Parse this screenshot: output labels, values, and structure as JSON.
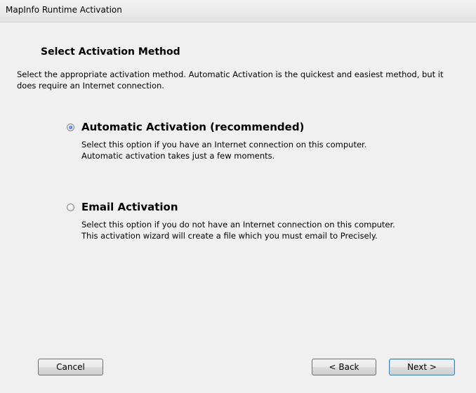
{
  "window": {
    "title": "MapInfo Runtime Activation"
  },
  "page": {
    "heading": "Select Activation Method",
    "intro": "Select the appropriate activation method.  Automatic Activation is the quickest and easiest method, but it does require an Internet connection."
  },
  "options": [
    {
      "label": "Automatic Activation (recommended)",
      "description": "Select this option if you have an Internet connection on this computer. Automatic activation takes just a few moments.",
      "selected": true
    },
    {
      "label": "Email Activation",
      "description": "Select this option if you do not have an Internet connection on this computer.  This activation wizard will create a file which you must email to Precisely.",
      "selected": false
    }
  ],
  "buttons": {
    "cancel": "Cancel",
    "back": "< Back",
    "next": "Next >"
  }
}
